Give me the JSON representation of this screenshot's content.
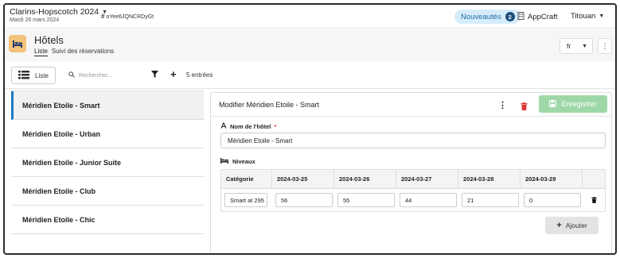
{
  "topbar": {
    "project_name": "Clarins-Hopscotch 2024",
    "project_date": "Mardi 26 mars 2024",
    "hash": "oYee6JQNCRDyGt",
    "news_label": "Nouveautés",
    "news_count": "2",
    "appcraft_label": "AppCraft",
    "user_name": "Titouan"
  },
  "header": {
    "title": "Hôtels",
    "tabs": [
      "Liste",
      "Suivi des réservations"
    ],
    "lang": "fr"
  },
  "toolbar": {
    "view_label": "Liste",
    "search_placeholder": "Rechercher...",
    "entries": "5 entrées"
  },
  "list": {
    "items": [
      "Méridien Etoile - Smart",
      "Méridien Etoile - Urban",
      "Méridien Etoile - Junior Suite",
      "Méridien Etoile - Club",
      "Méridien Etoile - Chic"
    ],
    "selected_index": 0
  },
  "panel": {
    "title": "Modifier Méridien Etoile - Smart",
    "save_label": "Enregistrer",
    "name_label": "Nom de l'hôtel",
    "required_mark": "*",
    "name_value": "Méridien Etoile - Smart",
    "levels_label": "Niveaux",
    "table": {
      "headers": [
        "Catégorie",
        "2024-03-25",
        "2024-03-26",
        "2024-03-27",
        "2024-03-28",
        "2024-03-29"
      ],
      "rows": [
        [
          "Smart at 295",
          "56",
          "55",
          "44",
          "21",
          "0"
        ]
      ]
    },
    "add_label": "Ajouter"
  },
  "colors": {
    "accent_blue": "#1a7bc4",
    "save_green": "#9fd8a8",
    "danger_red": "#e03a3a",
    "hotel_icon_bg": "#f2c37a"
  }
}
